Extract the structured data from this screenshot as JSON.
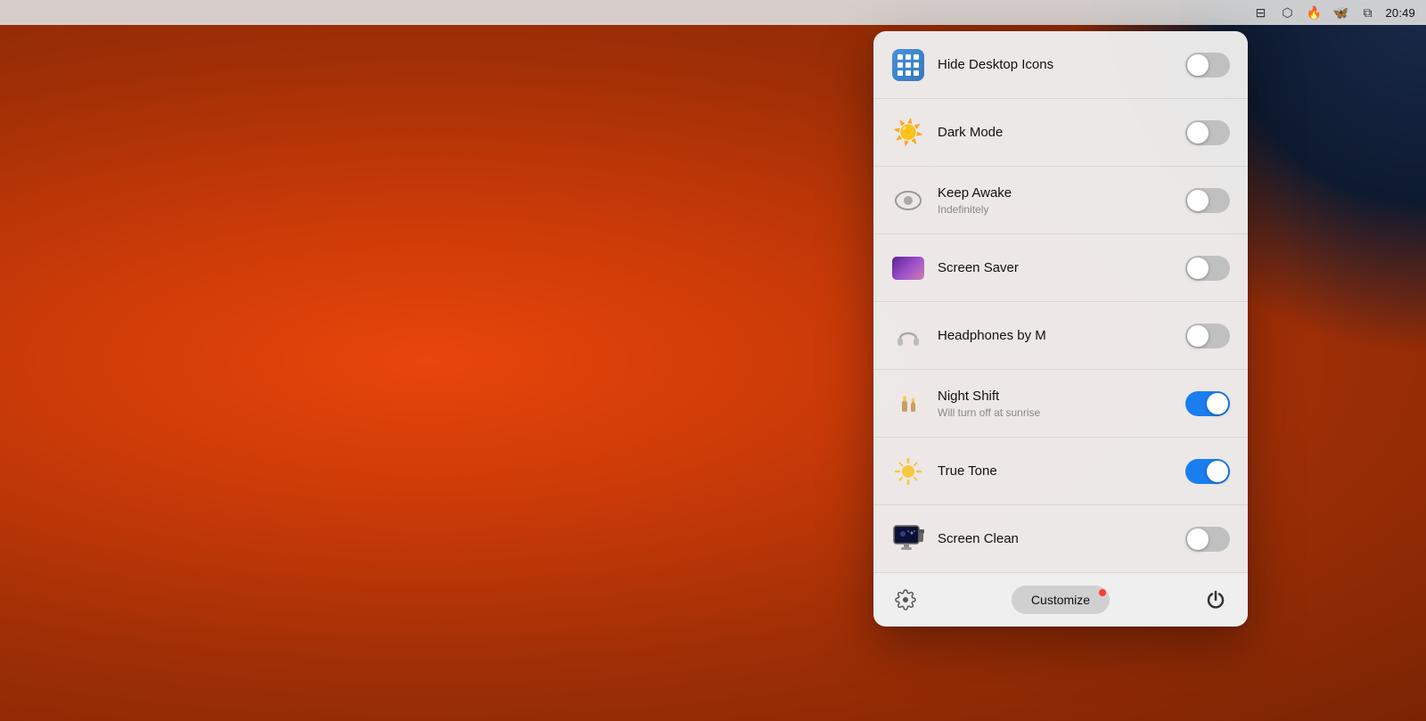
{
  "menubar": {
    "time": "20:49",
    "icons": [
      "storage-icon",
      "upload-icon",
      "flame-icon",
      "butterfly-icon",
      "remote-icon"
    ]
  },
  "panel": {
    "items": [
      {
        "id": "hide-desktop-icons",
        "icon_type": "grid",
        "title": "Hide Desktop Icons",
        "subtitle": "",
        "toggle": false
      },
      {
        "id": "dark-mode",
        "icon_type": "sun",
        "title": "Dark Mode",
        "subtitle": "",
        "toggle": false
      },
      {
        "id": "keep-awake",
        "icon_type": "keepawake",
        "title": "Keep Awake",
        "subtitle": "Indefinitely",
        "toggle": false
      },
      {
        "id": "screen-saver",
        "icon_type": "screensaver",
        "title": "Screen Saver",
        "subtitle": "",
        "toggle": false
      },
      {
        "id": "headphones",
        "icon_type": "headphones",
        "title": "Headphones by M",
        "subtitle": "",
        "toggle": false
      },
      {
        "id": "night-shift",
        "icon_type": "nightshift",
        "title": "Night Shift",
        "subtitle": "Will turn off at sunrise",
        "toggle": true
      },
      {
        "id": "true-tone",
        "icon_type": "truetone",
        "title": "True Tone",
        "subtitle": "",
        "toggle": true
      },
      {
        "id": "screen-clean",
        "icon_type": "screenclean",
        "title": "Screen Clean",
        "subtitle": "",
        "toggle": false
      }
    ],
    "bottom": {
      "customize_label": "Customize",
      "has_notification": true
    }
  }
}
